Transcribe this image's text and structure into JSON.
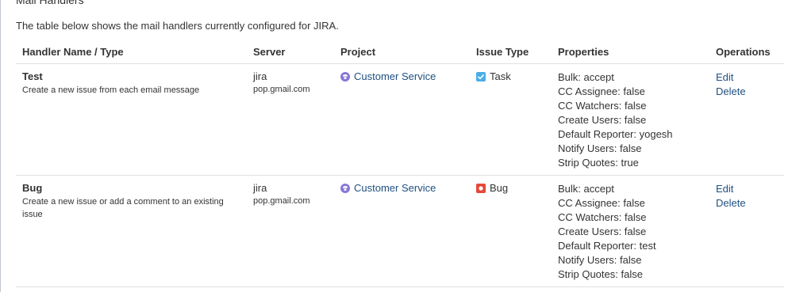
{
  "section": {
    "title": "Mail Handlers",
    "description": "The table below shows the mail handlers currently configured for JIRA."
  },
  "table": {
    "headers": [
      "Handler Name / Type",
      "Server",
      "Project",
      "Issue Type",
      "Properties",
      "Operations"
    ],
    "rows": [
      {
        "name": "Test",
        "type": "Create a new issue from each email message",
        "server_name": "jira",
        "server_host": "pop.gmail.com",
        "project": "Customer Service",
        "project_icon": "project-avatar-icon",
        "issue_type": "Task",
        "issue_icon": "task-checkbox-icon",
        "properties": [
          "Bulk: accept",
          "CC Assignee: false",
          "CC Watchers: false",
          "Create Users: false",
          "Default Reporter: yogesh",
          "Notify Users: false",
          "Strip Quotes: true"
        ],
        "operations": [
          "Edit",
          "Delete"
        ]
      },
      {
        "name": "Bug",
        "type": "Create a new issue or add a comment to an existing issue",
        "server_name": "jira",
        "server_host": "pop.gmail.com",
        "project": "Customer Service",
        "project_icon": "project-avatar-icon",
        "issue_type": "Bug",
        "issue_icon": "bug-icon",
        "properties": [
          "Bulk: accept",
          "CC Assignee: false",
          "CC Watchers: false",
          "Create Users: false",
          "Default Reporter: test",
          "Notify Users: false",
          "Strip Quotes: false"
        ],
        "operations": [
          "Edit",
          "Delete"
        ]
      }
    ]
  },
  "colors": {
    "link": "#205081",
    "task_icon": "#4bade8",
    "bug_icon": "#e5493a",
    "project_icon": "#8777d9"
  }
}
